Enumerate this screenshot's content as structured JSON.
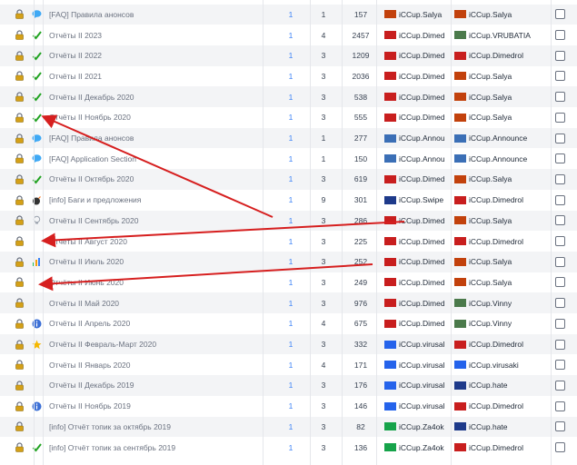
{
  "colors": {
    "accent": "#3b82f6",
    "arrow": "#d61f1f",
    "check": "#22a322",
    "row_alt": "#f3f4f6"
  },
  "rows": [
    {
      "icon": "speech-bubble-icon",
      "title": "[FAQ] Правила анонсов",
      "c1": "1",
      "c2": "1",
      "c3": "157",
      "u1": "iCCup.Salya",
      "u1c": "#c2410c",
      "u2": "iCCup.Salya",
      "u2c": "#c2410c"
    },
    {
      "icon": "check-icon",
      "title": "Отчёты II 2023",
      "c1": "1",
      "c2": "4",
      "c3": "2457",
      "u1": "iCCup.Dimedrol",
      "u1c": "#c81e1e",
      "u2": "iCCup.VRUBATIA",
      "u2c": "#4b7a4b"
    },
    {
      "icon": "check-icon",
      "title": "Отчёты II 2022",
      "c1": "1",
      "c2": "3",
      "c3": "1209",
      "u1": "iCCup.Dimedrol",
      "u1c": "#c81e1e",
      "u2": "iCCup.Dimedrol",
      "u2c": "#c81e1e"
    },
    {
      "icon": "check-icon",
      "title": "Отчёты II 2021",
      "c1": "1",
      "c2": "3",
      "c3": "2036",
      "u1": "iCCup.Dimedrol",
      "u1c": "#c81e1e",
      "u2": "iCCup.Salya",
      "u2c": "#c2410c"
    },
    {
      "icon": "check-icon",
      "title": "Отчёты II Декабрь 2020",
      "c1": "1",
      "c2": "3",
      "c3": "538",
      "u1": "iCCup.Dimedrol",
      "u1c": "#c81e1e",
      "u2": "iCCup.Salya",
      "u2c": "#c2410c"
    },
    {
      "icon": "check-icon",
      "title": "Отчёты II Ноябрь 2020",
      "c1": "1",
      "c2": "3",
      "c3": "555",
      "u1": "iCCup.Dimedrol",
      "u1c": "#c81e1e",
      "u2": "iCCup.Salya",
      "u2c": "#c2410c"
    },
    {
      "icon": "speech-bubble-icon",
      "title": "[FAQ] Правила анонсов",
      "c1": "1",
      "c2": "1",
      "c3": "277",
      "u1": "iCCup.Announce",
      "u1c": "#3b6fb6",
      "u2": "iCCup.Announce",
      "u2c": "#3b6fb6"
    },
    {
      "icon": "speech-bubble-icon",
      "title": "[FAQ] Application Section",
      "c1": "1",
      "c2": "1",
      "c3": "150",
      "u1": "iCCup.Announce",
      "u1c": "#3b6fb6",
      "u2": "iCCup.Announce",
      "u2c": "#3b6fb6"
    },
    {
      "icon": "check-icon",
      "title": "Отчёты II Октябрь 2020",
      "c1": "1",
      "c2": "3",
      "c3": "619",
      "u1": "iCCup.Dimedrol",
      "u1c": "#c81e1e",
      "u2": "iCCup.Salya",
      "u2c": "#c2410c"
    },
    {
      "icon": "bomb-icon",
      "title": "[info] Баги и предложения",
      "c1": "1",
      "c2": "9",
      "c3": "301",
      "u1": "iCCup.Swipe",
      "u1c": "#1e3a8a",
      "u2": "iCCup.Dimedrol",
      "u2c": "#c81e1e"
    },
    {
      "icon": "lightbulb-icon",
      "title": "Отчёты II Сентябрь 2020",
      "c1": "1",
      "c2": "3",
      "c3": "286",
      "u1": "iCCup.Dimedrol",
      "u1c": "#c81e1e",
      "u2": "iCCup.Salya",
      "u2c": "#c2410c"
    },
    {
      "icon": "",
      "title": "Отчёты II Август 2020",
      "c1": "1",
      "c2": "3",
      "c3": "225",
      "u1": "iCCup.Dimedrol",
      "u1c": "#c81e1e",
      "u2": "iCCup.Dimedrol",
      "u2c": "#c81e1e"
    },
    {
      "icon": "bar-chart-icon",
      "title": "Отчёты II Июль 2020",
      "c1": "1",
      "c2": "3",
      "c3": "252",
      "u1": "iCCup.Dimedrol",
      "u1c": "#c81e1e",
      "u2": "iCCup.Salya",
      "u2c": "#c2410c"
    },
    {
      "icon": "",
      "title": "Отчёты II Июнь 2020",
      "c1": "1",
      "c2": "3",
      "c3": "249",
      "u1": "iCCup.Dimedrol",
      "u1c": "#c81e1e",
      "u2": "iCCup.Salya",
      "u2c": "#c2410c"
    },
    {
      "icon": "",
      "title": "Отчёты II Май 2020",
      "c1": "1",
      "c2": "3",
      "c3": "976",
      "u1": "iCCup.Dimedrol",
      "u1c": "#c81e1e",
      "u2": "iCCup.Vinny",
      "u2c": "#4b7a4b"
    },
    {
      "icon": "info-icon",
      "title": "Отчёты II Апрель 2020",
      "c1": "1",
      "c2": "4",
      "c3": "675",
      "u1": "iCCup.Dimedrol",
      "u1c": "#c81e1e",
      "u2": "iCCup.Vinny",
      "u2c": "#4b7a4b"
    },
    {
      "icon": "star-icon",
      "title": "Отчёты II Февраль-Март 2020",
      "c1": "1",
      "c2": "3",
      "c3": "332",
      "u1": "iCCup.virusaki",
      "u1c": "#2563eb",
      "u2": "iCCup.Dimedrol",
      "u2c": "#c81e1e"
    },
    {
      "icon": "",
      "title": "Отчёты II Январь 2020",
      "c1": "1",
      "c2": "4",
      "c3": "171",
      "u1": "iCCup.virusaki",
      "u1c": "#2563eb",
      "u2": "iCCup.virusaki",
      "u2c": "#2563eb"
    },
    {
      "icon": "",
      "title": "Отчёты II Декабрь 2019",
      "c1": "1",
      "c2": "3",
      "c3": "176",
      "u1": "iCCup.virusaki",
      "u1c": "#2563eb",
      "u2": "iCCup.hate",
      "u2c": "#1e3a8a"
    },
    {
      "icon": "info-icon",
      "title": "Отчёты II Ноябрь 2019",
      "c1": "1",
      "c2": "3",
      "c3": "146",
      "u1": "iCCup.virusaki",
      "u1c": "#2563eb",
      "u2": "iCCup.Dimedrol",
      "u2c": "#c81e1e"
    },
    {
      "icon": "",
      "title": "[info] Отчёт топик за октябрь 2019",
      "c1": "1",
      "c2": "3",
      "c3": "82",
      "u1": "iCCup.Za4ok",
      "u1c": "#16a34a",
      "u2": "iCCup.hate",
      "u2c": "#1e3a8a"
    },
    {
      "icon": "check-icon",
      "title": "[info] Отчёт топик за сентябрь 2019",
      "c1": "1",
      "c2": "3",
      "c3": "136",
      "u1": "iCCup.Za4ok",
      "u1c": "#16a34a",
      "u2": "iCCup.Dimedrol",
      "u2c": "#c81e1e"
    }
  ]
}
